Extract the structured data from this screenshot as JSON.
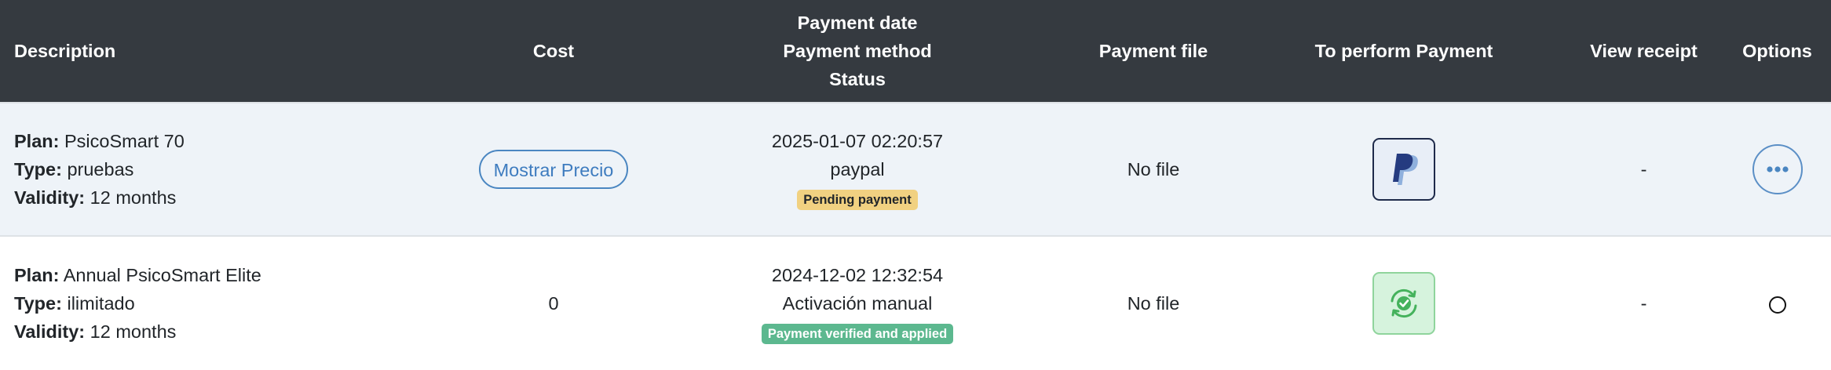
{
  "headers": {
    "description": "Description",
    "cost": "Cost",
    "payment_date": "Payment date",
    "payment_method": "Payment method",
    "status": "Status",
    "payment_file": "Payment file",
    "to_perform_payment": "To perform Payment",
    "view_receipt": "View receipt",
    "options": "Options"
  },
  "labels": {
    "plan": "Plan:",
    "type": "Type:",
    "validity": "Validity:"
  },
  "rows": [
    {
      "plan": "PsicoSmart 70",
      "type": "pruebas",
      "validity": "12 months",
      "cost_button": "Mostrar Precio",
      "date": "2025-01-07 02:20:57",
      "method": "paypal",
      "status": "Pending payment",
      "file": "No file",
      "pay_icon": "paypal-icon",
      "receipt": "-",
      "options_icon": "more-horizontal-icon"
    },
    {
      "plan": "Annual PsicoSmart Elite",
      "type": "ilimitado",
      "validity": "12 months",
      "cost": "0",
      "date": "2024-12-02 12:32:54",
      "method": "Activación manual",
      "status": "Payment verified and applied",
      "file": "No file",
      "pay_icon": "sync-check-icon",
      "receipt": "-",
      "options_icon": "radio-icon"
    }
  ],
  "colors": {
    "header_bg": "#353a40",
    "row_highlight": "#eef3f8",
    "accent_blue": "#3e7cbf",
    "pending_badge": "#f1d181",
    "verified_badge": "#5cb88f"
  }
}
